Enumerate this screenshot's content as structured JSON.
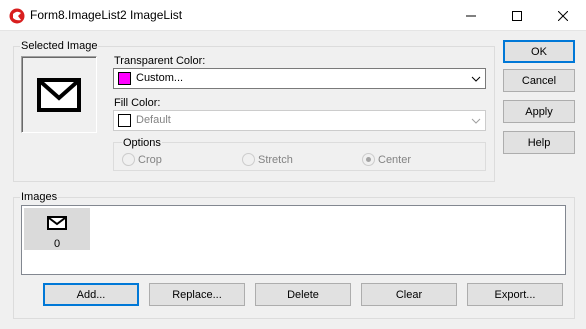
{
  "window": {
    "title": "Form8.ImageList2 ImageList",
    "controls": [
      "minimize-icon",
      "maximize-icon",
      "close-icon"
    ]
  },
  "selected_image": {
    "label": "Selected Image"
  },
  "transparent_color": {
    "label": "Transparent Color:",
    "value": "Custom...",
    "swatch_color": "#ff00ff"
  },
  "fill_color": {
    "label": "Fill Color:",
    "value": "Default",
    "swatch_color": "#ffffff",
    "enabled": false
  },
  "options": {
    "label": "Options",
    "crop": "Crop",
    "stretch": "Stretch",
    "center": "Center",
    "selected": "Center"
  },
  "side_buttons": {
    "ok": "OK",
    "cancel": "Cancel",
    "apply": "Apply",
    "help": "Help"
  },
  "images": {
    "label": "Images",
    "items": [
      {
        "index": "0",
        "icon": "envelope-icon"
      }
    ]
  },
  "bottom_buttons": {
    "add": "Add...",
    "replace": "Replace...",
    "delete": "Delete",
    "clear": "Clear",
    "export": "Export..."
  },
  "colors": {
    "accent": "#0078d7"
  }
}
